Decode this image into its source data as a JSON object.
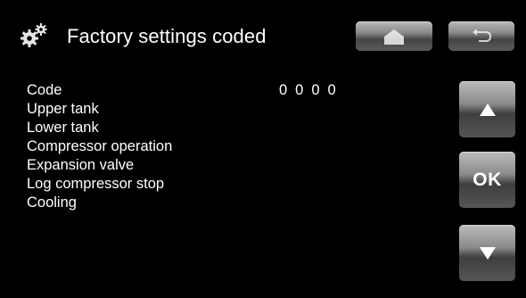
{
  "header": {
    "icon": "gears-icon",
    "title": "Factory settings coded"
  },
  "nav": {
    "home_icon": "home-icon",
    "back_icon": "back-arrow-icon"
  },
  "menu": {
    "items": [
      {
        "label": "Code"
      },
      {
        "label": "Upper tank"
      },
      {
        "label": "Lower tank"
      },
      {
        "label": "Compressor operation"
      },
      {
        "label": "Expansion valve"
      },
      {
        "label": "Log compressor stop"
      },
      {
        "label": "Cooling"
      }
    ],
    "code_value": "0 0 0 0"
  },
  "controls": {
    "up_icon": "arrow-up-icon",
    "ok_label": "OK",
    "down_icon": "arrow-down-icon"
  },
  "colors": {
    "background": "#000000",
    "text": "#ffffff",
    "button_light": "#bcbcbc",
    "button_dark": "#3e3e3e"
  }
}
